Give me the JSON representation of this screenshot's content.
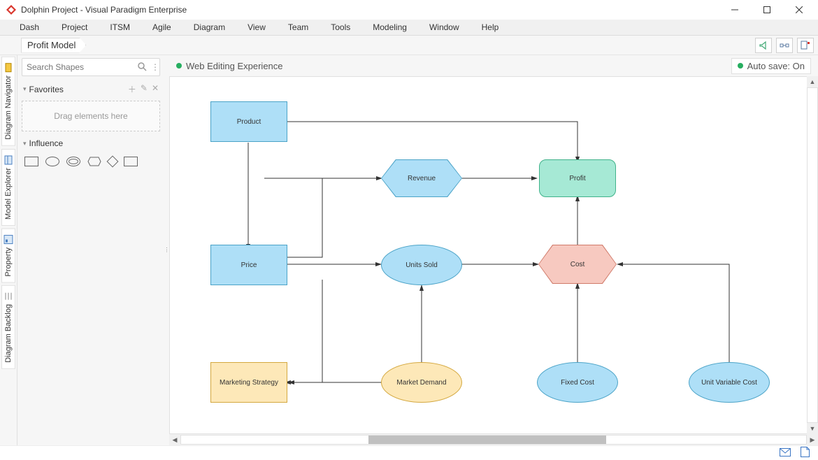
{
  "window": {
    "title": "Dolphin Project - Visual Paradigm Enterprise"
  },
  "menu": [
    "Dash",
    "Project",
    "ITSM",
    "Agile",
    "Diagram",
    "View",
    "Team",
    "Tools",
    "Modeling",
    "Window",
    "Help"
  ],
  "breadcrumb": "Profit Model",
  "search": {
    "placeholder": "Search Shapes"
  },
  "panels": {
    "favorites": {
      "title": "Favorites",
      "placeholder": "Drag elements here"
    },
    "influence": {
      "title": "Influence"
    }
  },
  "side_tabs": [
    "Diagram Navigator",
    "Model Explorer",
    "Property",
    "Diagram Backlog"
  ],
  "status": {
    "left": "Web Editing Experience",
    "right": "Auto save: On"
  },
  "nodes": {
    "product": "Product",
    "price": "Price",
    "revenue": "Revenue",
    "profit": "Profit",
    "units_sold": "Units Sold",
    "cost": "Cost",
    "marketing_strategy": "Marketing Strategy",
    "market_demand": "Market Demand",
    "fixed_cost": "Fixed Cost",
    "unit_variable_cost": "Unit Variable Cost"
  }
}
